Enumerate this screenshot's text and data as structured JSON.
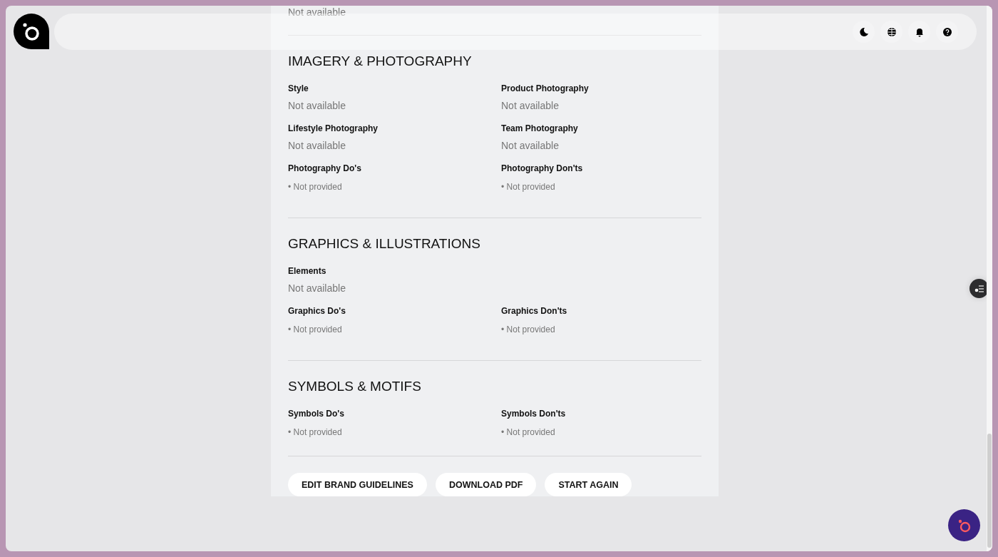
{
  "top_value": "Not available",
  "sections": [
    {
      "title": "IMAGERY & PHOTOGRAPHY",
      "rows": [
        [
          {
            "label": "Style",
            "kind": "text",
            "value": "Not available"
          },
          {
            "label": "Product Photography",
            "kind": "text",
            "value": "Not available"
          }
        ],
        [
          {
            "label": "Lifestyle Photography",
            "kind": "text",
            "value": "Not available"
          },
          {
            "label": "Team Photography",
            "kind": "text",
            "value": "Not available"
          }
        ],
        [
          {
            "label": "Photography Do's",
            "kind": "list",
            "items": [
              "• Not provided"
            ]
          },
          {
            "label": "Photography Don'ts",
            "kind": "list",
            "items": [
              "• Not provided"
            ]
          }
        ]
      ]
    },
    {
      "title": "GRAPHICS & ILLUSTRATIONS",
      "rows": [
        [
          {
            "label": "Elements",
            "kind": "text",
            "value": "Not available"
          }
        ],
        [
          {
            "label": "Graphics Do's",
            "kind": "list",
            "items": [
              "• Not provided"
            ]
          },
          {
            "label": "Graphics Don'ts",
            "kind": "list",
            "items": [
              "• Not provided"
            ]
          }
        ]
      ]
    },
    {
      "title": "SYMBOLS & MOTIFS",
      "rows": [
        [
          {
            "label": "Symbols Do's",
            "kind": "list",
            "items": [
              "• Not provided"
            ]
          },
          {
            "label": "Symbols Don'ts",
            "kind": "list",
            "items": [
              "• Not provided"
            ]
          }
        ]
      ]
    }
  ],
  "buttons": [
    "EDIT BRAND GUIDELINES",
    "DOWNLOAD PDF",
    "START AGAIN"
  ]
}
